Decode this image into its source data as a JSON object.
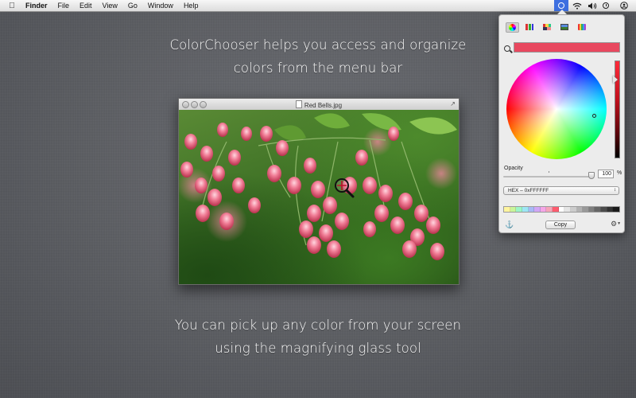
{
  "menubar": {
    "apple_icon": "apple-logo-icon",
    "items": [
      "Finder",
      "File",
      "Edit",
      "View",
      "Go",
      "Window",
      "Help"
    ],
    "status_icons": [
      "colorchooser-icon",
      "wifi-icon",
      "volume-icon",
      "clock-icon",
      "user-icon"
    ]
  },
  "captions": {
    "top_line1": "ColorChooser helps you access and organize",
    "top_line2": "colors from the menu bar",
    "bottom_line1": "You can pick up any color from your screen",
    "bottom_line2": "using the magnifying glass tool"
  },
  "photo_window": {
    "title": "Red Bells.jpg"
  },
  "colorchooser": {
    "modes": [
      "color-wheel",
      "color-sliders",
      "color-palettes",
      "image-palettes",
      "pencils"
    ],
    "current_color": "#e8485f",
    "opacity_label": "Opacity",
    "opacity_value": "100",
    "opacity_fraction": 1.0,
    "opacity_unit": "%",
    "format_value": "HEX – 0xFFFFFF",
    "swatches": [
      "#fff59e",
      "#c9f59a",
      "#9df5c7",
      "#9de6f5",
      "#a8b8f5",
      "#d1a6f5",
      "#f5a6e6",
      "#f5a6b8",
      "#ff5b6e",
      "#ffffff",
      "#e5e5e5",
      "#cccccc",
      "#b2b2b2",
      "#999999",
      "#7f7f7f",
      "#666666",
      "#4c4c4c",
      "#333333",
      "#1a1a1a"
    ],
    "copy_label": "Copy",
    "brightness_color": "#ff2b3a"
  }
}
